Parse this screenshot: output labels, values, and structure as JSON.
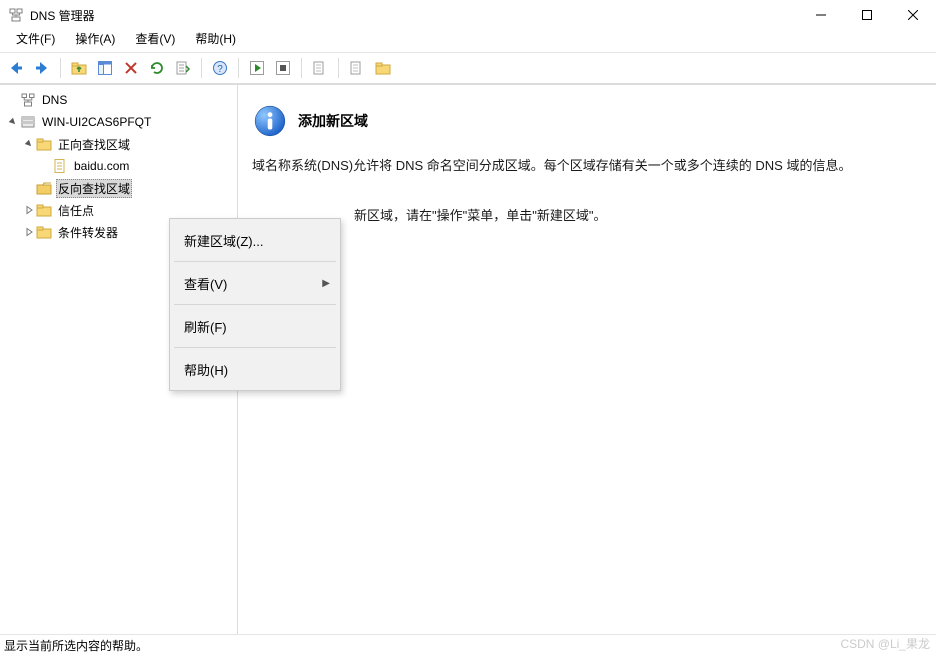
{
  "window": {
    "title": "DNS 管理器"
  },
  "menu": {
    "file": "文件(F)",
    "action": "操作(A)",
    "view": "查看(V)",
    "help": "帮助(H)"
  },
  "tree": {
    "root_label": "DNS",
    "server_label": "WIN-UI2CAS6PFQT",
    "forward_lookup": "正向查找区域",
    "baidu": "baidu.com",
    "reverse_lookup": "反向查找区域",
    "trust_points": "信任点",
    "conditional_forwarders": "条件转发器"
  },
  "content": {
    "title": "添加新区域",
    "body1": "域名称系统(DNS)允许将 DNS 命名空间分成区域。每个区域存储有关一个或多个连续的 DNS 域的信息。",
    "body2_prefix": "新区域，请在\"操作\"菜单，单击\"新建区域\"。"
  },
  "context_menu": {
    "new_zone": "新建区域(Z)...",
    "view": "查看(V)",
    "refresh": "刷新(F)",
    "help": "帮助(H)"
  },
  "status": {
    "text": "显示当前所选内容的帮助。"
  },
  "watermark": "CSDN @Li_果龙"
}
